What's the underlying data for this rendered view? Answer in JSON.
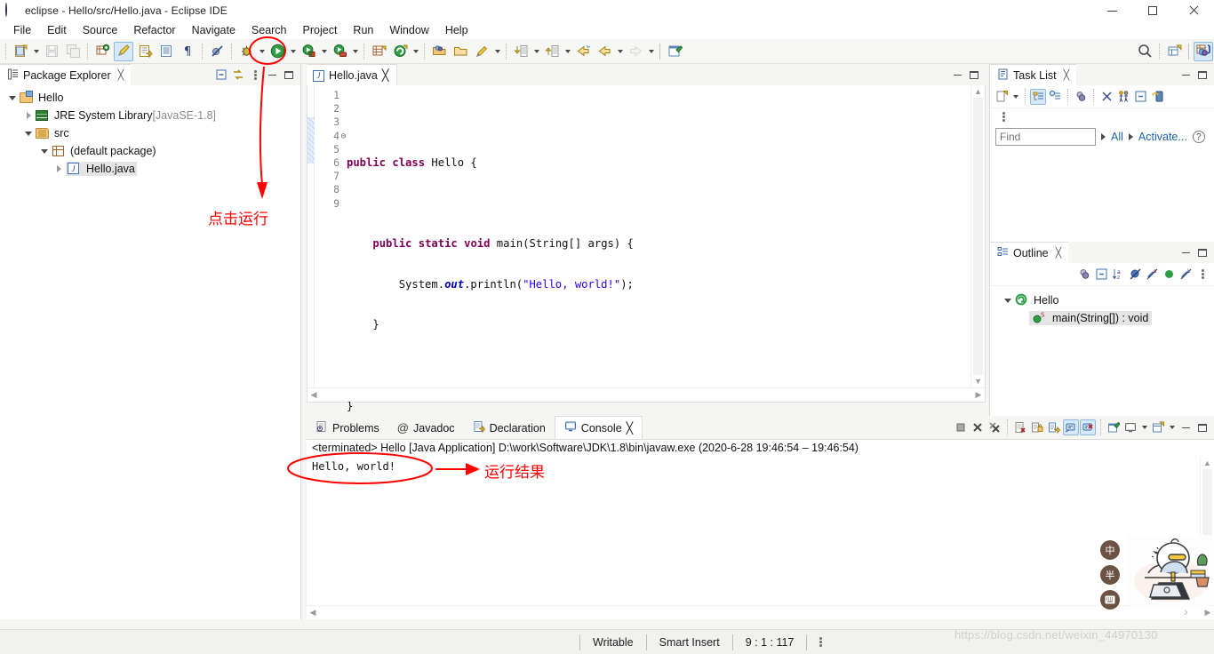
{
  "window": {
    "title": "eclipse - Hello/src/Hello.java - Eclipse IDE",
    "app_icon": "eclipse-globe-icon",
    "minimize_label": "Minimize",
    "maximize_label": "Maximize",
    "close_label": "Close"
  },
  "menubar": {
    "items": [
      {
        "label": "File",
        "mnemonic": "F"
      },
      {
        "label": "Edit",
        "mnemonic": "E"
      },
      {
        "label": "Source",
        "mnemonic": "S"
      },
      {
        "label": "Refactor",
        "mnemonic": "t"
      },
      {
        "label": "Navigate",
        "mnemonic": "N"
      },
      {
        "label": "Search",
        "mnemonic": "a"
      },
      {
        "label": "Project",
        "mnemonic": "P"
      },
      {
        "label": "Run",
        "mnemonic": "R"
      },
      {
        "label": "Window",
        "mnemonic": "W"
      },
      {
        "label": "Help",
        "mnemonic": "H"
      }
    ]
  },
  "toolbar": {
    "items": [
      {
        "name": "new-wizard-icon",
        "tip": "New"
      },
      {
        "name": "save-icon",
        "tip": "Save"
      },
      {
        "name": "save-all-icon",
        "tip": "Save All"
      },
      {
        "name": "new-java-package-icon",
        "tip": "New Java Package"
      },
      {
        "name": "toggle-mark-occurrences-icon",
        "tip": "Toggle Mark Occurrences"
      },
      {
        "name": "open-task-icon",
        "tip": "Open Task"
      },
      {
        "name": "open-type-icon",
        "tip": "Open Type"
      },
      {
        "name": "show-whitespace-icon",
        "tip": "Show Whitespace Characters"
      },
      {
        "name": "skip-all-breakpoints-icon",
        "tip": "Skip All Breakpoints"
      },
      {
        "name": "debug-icon",
        "tip": "Debug"
      },
      {
        "name": "run-icon",
        "tip": "Run"
      },
      {
        "name": "run-external-tools-icon",
        "tip": "External Tools"
      },
      {
        "name": "coverage-icon",
        "tip": "Coverage"
      },
      {
        "name": "new-java-class-icon",
        "tip": "New Java Class"
      },
      {
        "name": "new-java-project-icon",
        "tip": "New Java Project"
      },
      {
        "name": "open-resource-icon",
        "tip": "Open Resource"
      },
      {
        "name": "open-folder-icon",
        "tip": "Open Folder"
      },
      {
        "name": "quick-fix-icon",
        "tip": "Quick Fix"
      },
      {
        "name": "next-annotation-icon",
        "tip": "Next Annotation"
      },
      {
        "name": "previous-annotation-icon",
        "tip": "Previous Annotation"
      },
      {
        "name": "back-history-icon",
        "tip": "Back"
      },
      {
        "name": "forward-history-icon",
        "tip": "Forward"
      },
      {
        "name": "pin-editor-icon",
        "tip": "Pin Editor"
      },
      {
        "name": "search-icon",
        "tip": "Search"
      },
      {
        "name": "new-window-icon",
        "tip": "New Window"
      },
      {
        "name": "java-perspective-icon",
        "tip": "Java Perspective"
      }
    ]
  },
  "package_explorer": {
    "tab_label": "Package Explorer",
    "tab_icon": "package-explorer-icon",
    "close_glyph": "╳",
    "toolbar": [
      {
        "name": "collapse-all-icon"
      },
      {
        "name": "link-with-editor-icon"
      },
      {
        "name": "view-menu-icon"
      },
      {
        "name": "minimize-view-icon"
      },
      {
        "name": "maximize-view-icon"
      }
    ],
    "tree": [
      {
        "label": "Hello",
        "indent": 0,
        "twisty": "down",
        "icon": "java-project-icon",
        "selected": false,
        "suffix": ""
      },
      {
        "label": "JRE System Library",
        "indent": 1,
        "twisty": "right",
        "icon": "jre-library-icon",
        "selected": false,
        "suffix": " [JavaSE-1.8]"
      },
      {
        "label": "src",
        "indent": 1,
        "twisty": "down",
        "icon": "source-folder-icon",
        "selected": false,
        "suffix": ""
      },
      {
        "label": "(default package)",
        "indent": 2,
        "twisty": "down",
        "icon": "package-icon",
        "selected": false,
        "suffix": ""
      },
      {
        "label": "Hello.java",
        "indent": 3,
        "twisty": "right",
        "icon": "java-file-icon",
        "selected": true,
        "suffix": ""
      }
    ]
  },
  "editor": {
    "tab_label": "Hello.java",
    "tab_icon": "java-file-icon",
    "close_glyph": "╳",
    "minimize_label": "Minimize",
    "maximize_label": "Maximize",
    "line_numbers": [
      "1",
      "2",
      "3",
      "4",
      "5",
      "6",
      "7",
      "8",
      "9"
    ],
    "fold_marker_line": "4",
    "fold_glyph": "⊖",
    "cursor_line": 9,
    "code_lines": [
      {
        "n": 1,
        "segments": []
      },
      {
        "n": 2,
        "segments": [
          {
            "t": "public",
            "c": "kw"
          },
          {
            "t": " ",
            "c": ""
          },
          {
            "t": "class",
            "c": "kw"
          },
          {
            "t": " Hello {",
            "c": ""
          }
        ]
      },
      {
        "n": 3,
        "segments": []
      },
      {
        "n": 4,
        "segments": [
          {
            "t": "    ",
            "c": ""
          },
          {
            "t": "public",
            "c": "kw"
          },
          {
            "t": " ",
            "c": ""
          },
          {
            "t": "static",
            "c": "kw"
          },
          {
            "t": " ",
            "c": ""
          },
          {
            "t": "void",
            "c": "kw"
          },
          {
            "t": " main(String[] args) {",
            "c": ""
          }
        ]
      },
      {
        "n": 5,
        "segments": [
          {
            "t": "        System.",
            "c": ""
          },
          {
            "t": "out",
            "c": "fld"
          },
          {
            "t": ".println(",
            "c": ""
          },
          {
            "t": "\"Hello, world!\"",
            "c": "str"
          },
          {
            "t": ");",
            "c": ""
          }
        ]
      },
      {
        "n": 6,
        "segments": [
          {
            "t": "    }",
            "c": ""
          }
        ]
      },
      {
        "n": 7,
        "segments": []
      },
      {
        "n": 8,
        "segments": [
          {
            "t": "}",
            "c": ""
          }
        ]
      },
      {
        "n": 9,
        "segments": []
      }
    ]
  },
  "task_list": {
    "tab_label": "Task List",
    "tab_icon": "task-list-icon",
    "close_glyph": "╳",
    "toolbar": [
      {
        "name": "new-task-icon"
      },
      {
        "name": "new-task-dropdown-icon"
      },
      {
        "name": "categorized-presentation-icon"
      },
      {
        "name": "scheduled-presentation-icon"
      },
      {
        "name": "focus-on-workweek-icon"
      },
      {
        "name": "filter-completed-tasks-icon"
      },
      {
        "name": "synchronize-changed-icon"
      },
      {
        "name": "collapse-all-icon"
      },
      {
        "name": "restore-task-icon"
      }
    ],
    "view_menu_icon": "view-menu-icon",
    "find_placeholder": "Find",
    "find_value": "",
    "all_label": "All",
    "activate_label": "Activate...",
    "help_icon": "help-icon",
    "minimize_label": "Minimize",
    "maximize_label": "Maximize"
  },
  "outline": {
    "tab_label": "Outline",
    "tab_icon": "outline-icon",
    "close_glyph": "╳",
    "toolbar": [
      {
        "name": "focus-on-active-task-icon"
      },
      {
        "name": "collapse-all-icon"
      },
      {
        "name": "sort-alphabetically-icon"
      },
      {
        "name": "hide-fields-icon"
      },
      {
        "name": "hide-static-members-icon"
      },
      {
        "name": "hide-non-public-members-icon"
      },
      {
        "name": "hide-local-types-icon"
      },
      {
        "name": "view-menu-icon"
      }
    ],
    "minimize_label": "Minimize",
    "maximize_label": "Maximize",
    "tree": [
      {
        "label": "Hello",
        "indent": 0,
        "twisty": "down",
        "icon": "java-class-icon",
        "selected": false,
        "modifier": ""
      },
      {
        "label": "main(String[]) : void",
        "indent": 1,
        "twisty": "none",
        "icon": "public-method-icon",
        "selected": true,
        "modifier": "S"
      }
    ]
  },
  "console": {
    "tabs": [
      {
        "label": "Problems",
        "icon": "problems-icon",
        "selected": false
      },
      {
        "label": "Javadoc",
        "icon": "javadoc-icon",
        "selected": false
      },
      {
        "label": "Declaration",
        "icon": "declaration-icon",
        "selected": false
      },
      {
        "label": "Console",
        "icon": "console-icon",
        "selected": true
      }
    ],
    "close_glyph": "╳",
    "toolbar": [
      {
        "name": "terminate-icon"
      },
      {
        "name": "remove-launch-icon"
      },
      {
        "name": "remove-all-terminated-icon"
      },
      {
        "name": "clear-console-icon"
      },
      {
        "name": "scroll-lock-icon"
      },
      {
        "name": "word-wrap-icon"
      },
      {
        "name": "show-console-on-output-icon"
      },
      {
        "name": "show-console-on-error-icon"
      },
      {
        "name": "pin-console-icon"
      },
      {
        "name": "display-selected-console-icon"
      },
      {
        "name": "display-selected-console-dropdown-icon"
      },
      {
        "name": "open-console-icon"
      },
      {
        "name": "open-console-dropdown-icon"
      },
      {
        "name": "minimize-view-icon"
      },
      {
        "name": "maximize-view-icon"
      }
    ],
    "launch_header": "<terminated> Hello [Java Application] D:\\work\\Software\\JDK\\1.8\\bin\\javaw.exe  (2020-6-28 19:46:54 – 19:46:54)",
    "output": "Hello, world!"
  },
  "statusbar": {
    "writable": "Writable",
    "insert_mode": "Smart Insert",
    "cursor_position": "9 : 1 : 117"
  },
  "annotations": [
    {
      "name": "click-run-annotation",
      "text": "点击运行",
      "color": "#ff0000"
    },
    {
      "name": "run-result-annotation",
      "text": "运行结果",
      "color": "#ff0000"
    }
  ],
  "watermark": "https://blog.csdn.net/weixin_44970130",
  "ime": {
    "chinese_mode_label": "中",
    "width_mode_label": "半",
    "keyboard_label": "⌨",
    "expand_glyph": "›"
  },
  "colors": {
    "accent": "#1b63b0",
    "keyword": "#7f0055",
    "string": "#2a00ff",
    "field": "#0000c0",
    "annotation_red": "#ff0000",
    "selection": "#e4e4e4",
    "current_line": "#eaf2fd"
  }
}
